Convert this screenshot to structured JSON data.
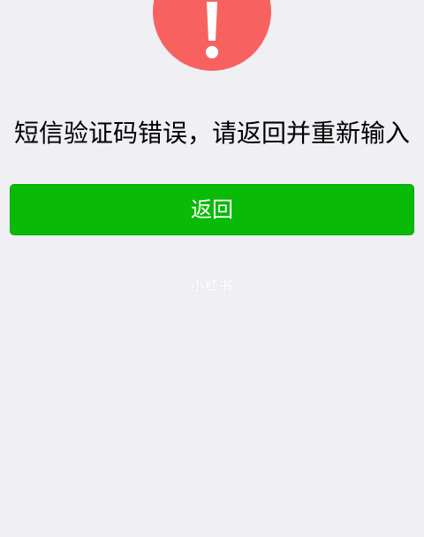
{
  "status": {
    "icon": "warning-exclamation-icon",
    "color": "#f76260"
  },
  "message": {
    "text": "短信验证码错误，请返回并重新输入"
  },
  "actions": {
    "back_label": "返回",
    "back_color": "#09bb07"
  },
  "watermark": {
    "text": "小红书"
  }
}
